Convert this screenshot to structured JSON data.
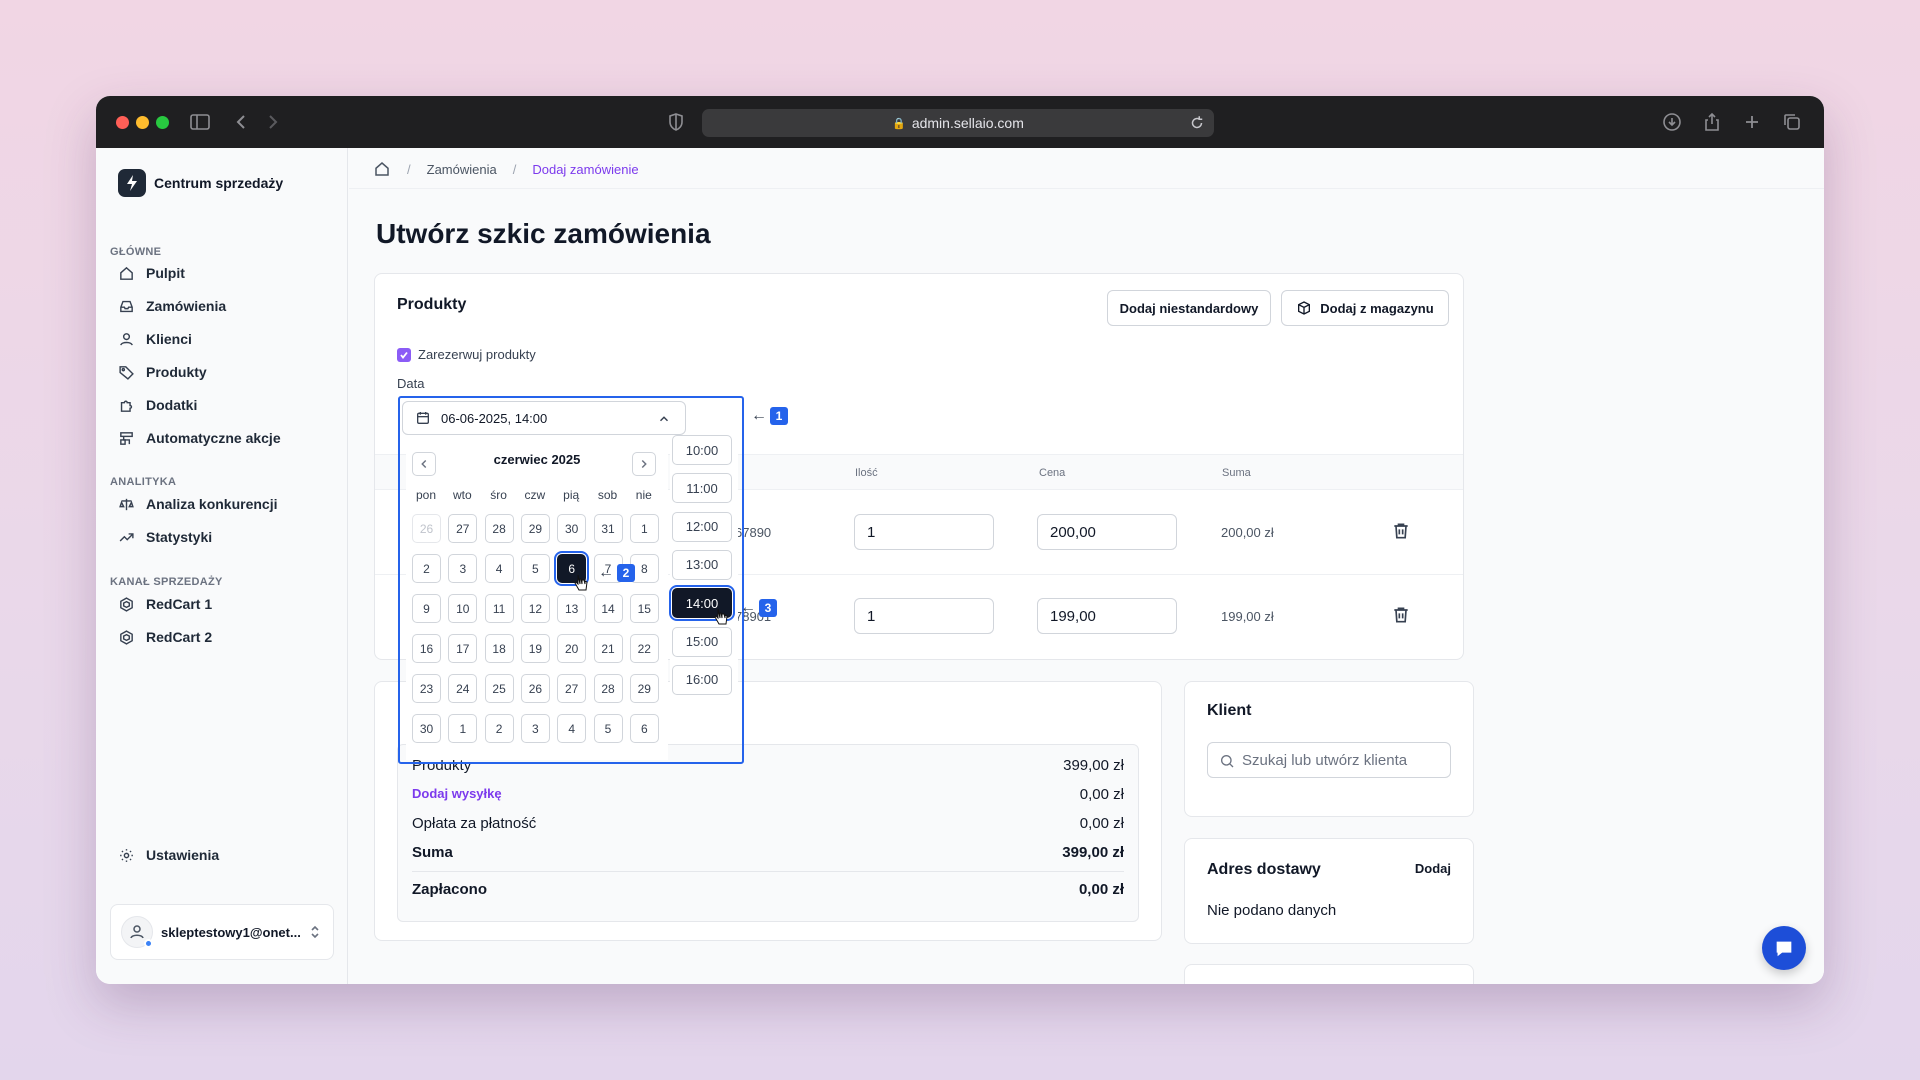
{
  "browser": {
    "url": "admin.sellaio.com"
  },
  "sidebar": {
    "brand": "Centrum sprzedaży",
    "sections": {
      "main": "GŁÓWNE",
      "analytics": "ANALITYKA",
      "channel": "KANAŁ SPRZEDAŻY"
    },
    "items": [
      {
        "label": "Pulpit",
        "icon": "home-icon"
      },
      {
        "label": "Zamówienia",
        "icon": "inbox-icon"
      },
      {
        "label": "Klienci",
        "icon": "user-icon"
      },
      {
        "label": "Produkty",
        "icon": "tag-icon"
      },
      {
        "label": "Dodatki",
        "icon": "puzzle-icon"
      },
      {
        "label": "Automatyczne akcje",
        "icon": "automation-icon"
      },
      {
        "label": "Analiza konkurencji",
        "icon": "scale-icon"
      },
      {
        "label": "Statystyki",
        "icon": "trend-icon"
      },
      {
        "label": "RedCart 1",
        "icon": "redcart-icon"
      },
      {
        "label": "RedCart 2",
        "icon": "redcart-icon"
      }
    ],
    "settings": "Ustawienia",
    "user": "skleptestowy1@onet..."
  },
  "breadcrumb": {
    "orders": "Zamówienia",
    "current": "Dodaj zamówienie"
  },
  "page": {
    "title": "Utwórz szkic zamówienia"
  },
  "products": {
    "title": "Produkty",
    "add_custom": "Dodaj niestandardowy",
    "add_from_stock": "Dodaj z magazynu",
    "reserve_label": "Zarezerwuj produkty",
    "reserve_checked": true,
    "date_label": "Data",
    "columns": {
      "qty": "Ilość",
      "price": "Cena",
      "sum": "Suma"
    },
    "rows": [
      {
        "sku_fragment": "67890",
        "qty": "1",
        "price": "200,00",
        "sum": "200,00 zł"
      },
      {
        "sku_fragment": "78901",
        "qty": "1",
        "price": "199,00",
        "sum": "199,00 zł"
      }
    ]
  },
  "summary": {
    "products_label": "Produkty",
    "products_value": "399,00 zł",
    "shipping_label": "Dodaj wysyłkę",
    "shipping_value": "0,00 zł",
    "fee_label": "Opłata za płatność",
    "fee_value": "0,00 zł",
    "total_label": "Suma",
    "total_value": "399,00 zł",
    "paid_label": "Zapłacono",
    "paid_value": "0,00 zł"
  },
  "client": {
    "title": "Klient",
    "search_placeholder": "Szukaj lub utwórz klienta"
  },
  "shipping_address": {
    "title": "Adres dostawy",
    "add": "Dodaj",
    "empty": "Nie podano danych"
  },
  "datepicker": {
    "value": "06-06-2025, 14:00",
    "month": "czerwiec 2025",
    "weekdays": [
      "pon",
      "wto",
      "śro",
      "czw",
      "pią",
      "sob",
      "nie"
    ],
    "weeks": [
      [
        "26",
        "27",
        "28",
        "29",
        "30",
        "31",
        "1"
      ],
      [
        "2",
        "3",
        "4",
        "5",
        "6",
        "7",
        "8"
      ],
      [
        "9",
        "10",
        "11",
        "12",
        "13",
        "14",
        "15"
      ],
      [
        "16",
        "17",
        "18",
        "19",
        "20",
        "21",
        "22"
      ],
      [
        "23",
        "24",
        "25",
        "26",
        "27",
        "28",
        "29"
      ],
      [
        "30",
        "1",
        "2",
        "3",
        "4",
        "5",
        "6"
      ]
    ],
    "selected_day": "6",
    "times": [
      "10:00",
      "11:00",
      "12:00",
      "13:00",
      "14:00",
      "15:00",
      "16:00"
    ],
    "selected_time": "14:00"
  },
  "markers": [
    "1",
    "2",
    "3"
  ],
  "colors": {
    "accent": "#7c3aed",
    "highlight": "#2563eb",
    "selected": "#111827"
  }
}
